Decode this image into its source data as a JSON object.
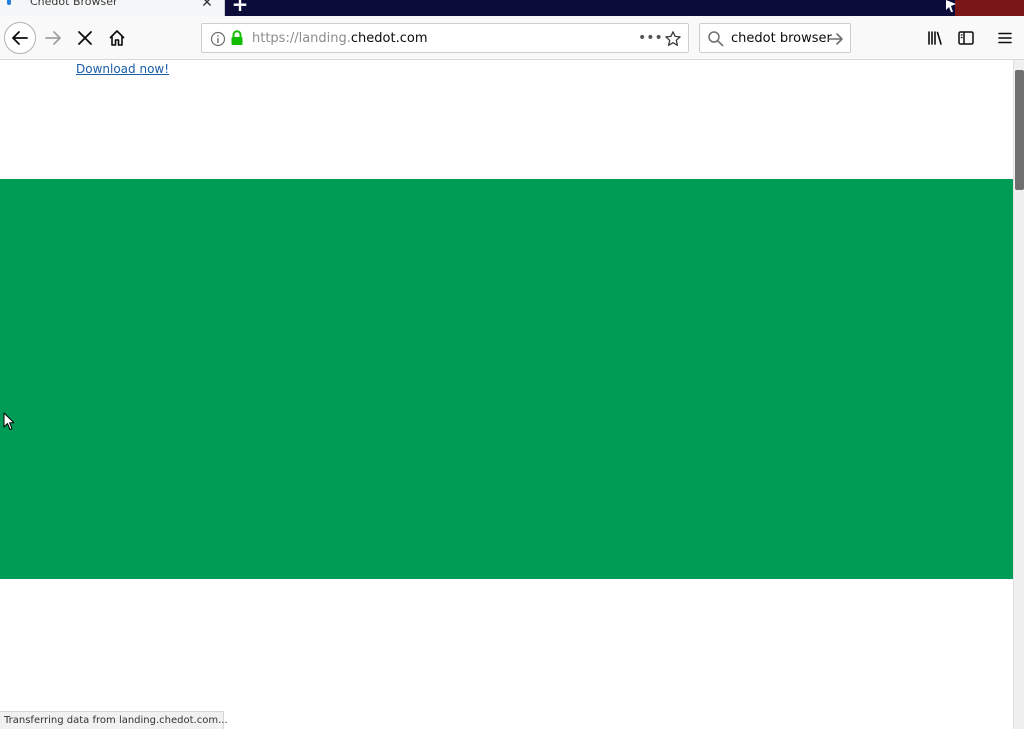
{
  "tab": {
    "title": "Chedot Browser",
    "close_glyph": "✕"
  },
  "new_tab_glyph": "+",
  "urlbar": {
    "url_prefix": "https://landing.",
    "url_domain": "chedot.com",
    "actions_glyph": "•••"
  },
  "searchbar": {
    "query": "chedot browser"
  },
  "page": {
    "download_link": "Download now!"
  },
  "status": {
    "text": "Transferring data from landing.chedot.com..."
  },
  "colors": {
    "banner": "#009b55",
    "tabbar": "#0c0c3a",
    "lock": "#12bc00",
    "link": "#1a5ea8"
  },
  "icons": [
    "back-arrow-icon",
    "forward-arrow-icon",
    "stop-icon",
    "home-icon",
    "info-icon",
    "lock-icon",
    "star-icon",
    "search-icon",
    "arrow-right-icon",
    "library-icon",
    "sidebar-icon",
    "hamburger-menu-icon"
  ]
}
